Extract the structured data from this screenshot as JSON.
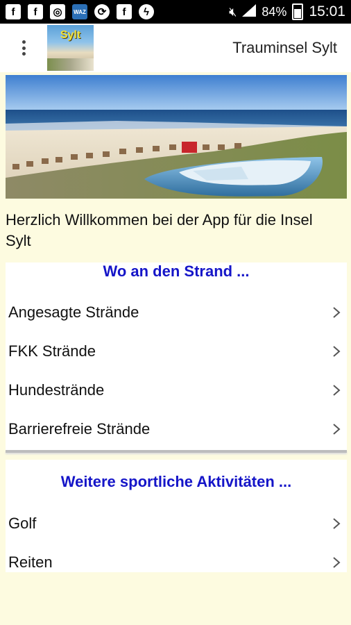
{
  "statusbar": {
    "battery": "84%",
    "time": "15:01",
    "notification_icons": [
      "facebook-icon",
      "facebook-icon",
      "instagram-icon",
      "waz-icon",
      "sync-icon",
      "facebook-icon",
      "messenger-icon"
    ],
    "waz_label": "WAZ"
  },
  "actionbar": {
    "logo_text": "Sylt",
    "title": "Trauminsel Sylt"
  },
  "welcome": "Herzlich Willkommen bei der App für die Insel Sylt",
  "sections": [
    {
      "heading": "Wo an den Strand ...",
      "items": [
        "Angesagte Strände",
        "FKK Strände",
        "Hundestrände",
        "Barrierefreie Strände"
      ]
    },
    {
      "heading": "Weitere sportliche Aktivitäten ...",
      "items": [
        "Golf",
        "Reiten"
      ]
    }
  ],
  "colors": {
    "background": "#fdfbe0",
    "heading": "#1515c8",
    "statusbar": "#000000"
  }
}
